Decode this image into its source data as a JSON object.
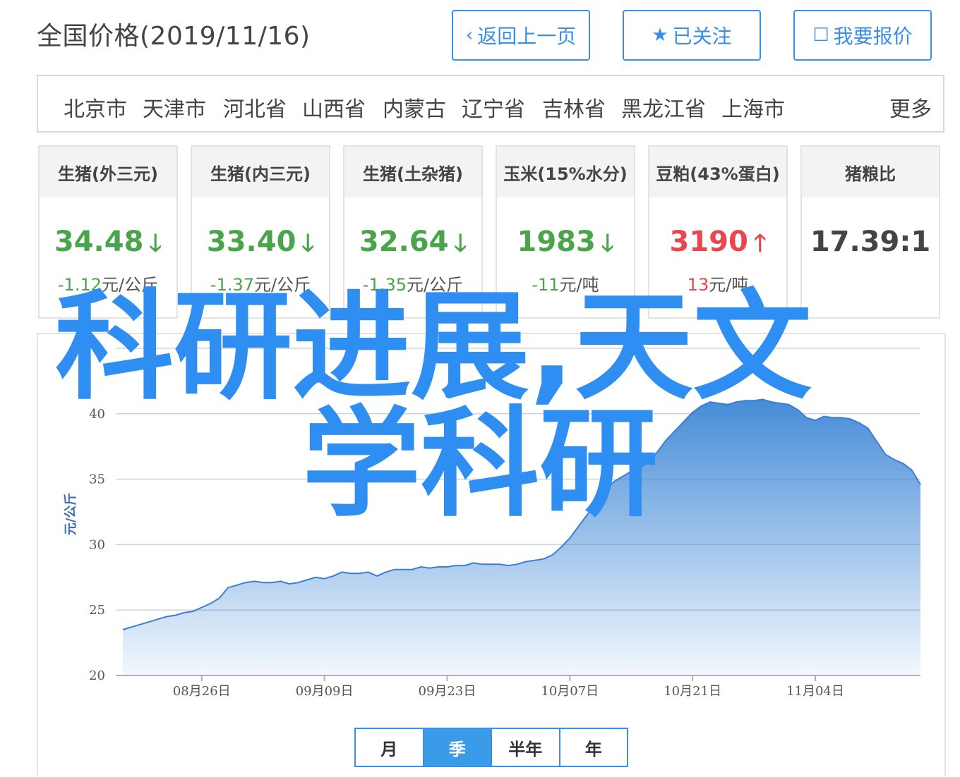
{
  "header": {
    "title": "全国价格(2019/11/16)",
    "back_label": "返回上一页",
    "follow_label": "已关注",
    "report_label": "我要报价"
  },
  "regions": [
    "北京市",
    "天津市",
    "河北省",
    "山西省",
    "内蒙古",
    "辽宁省",
    "吉林省",
    "黑龙江省",
    "上海市"
  ],
  "regions_more": "更多",
  "cards": [
    {
      "title": "生猪(外三元)",
      "value": "34.48",
      "trend": "down",
      "change_num": "-1.12",
      "change_unit": "元/公斤"
    },
    {
      "title": "生猪(内三元)",
      "value": "33.40",
      "trend": "down",
      "change_num": "-1.37",
      "change_unit": "元/公斤"
    },
    {
      "title": "生猪(土杂猪)",
      "value": "32.64",
      "trend": "down",
      "change_num": "-1.35",
      "change_unit": "元/公斤"
    },
    {
      "title": "玉米(15%水分)",
      "value": "1983",
      "trend": "down",
      "change_num": "-11",
      "change_unit": "元/吨"
    },
    {
      "title": "豆粕(43%蛋白)",
      "value": "3190",
      "trend": "up",
      "change_num": "13",
      "change_unit": "元/吨"
    },
    {
      "title": "猪粮比",
      "value": "17.39:1",
      "trend": "none",
      "change_num": "",
      "change_unit": ""
    }
  ],
  "colors": {
    "accent": "#3a8ee6",
    "down": "#4aa44a",
    "up": "#e8474d",
    "area": "#3c86d6"
  },
  "periods": [
    {
      "label": "月",
      "active": false
    },
    {
      "label": "季",
      "active": true
    },
    {
      "label": "半年",
      "active": false
    },
    {
      "label": "年",
      "active": false
    }
  ],
  "watermark": {
    "line1": "科研进展,天文",
    "line2": "学科研"
  },
  "chart_data": {
    "type": "area",
    "ylabel": "元/公斤",
    "ylim": [
      20,
      45
    ],
    "yticks": [
      20,
      25,
      30,
      35,
      40
    ],
    "grid": true,
    "x_start": "2019-08-17",
    "x_end": "2019-11-16",
    "x_ticks": [
      "08月26日",
      "09月09日",
      "09月23日",
      "10月07日",
      "10月21日",
      "11月04日"
    ],
    "x_tick_days": [
      9,
      23,
      37,
      51,
      65,
      79
    ],
    "days": [
      0,
      2,
      3,
      4,
      5,
      6,
      7,
      8,
      9,
      10,
      11,
      12,
      13,
      14,
      15,
      16,
      17,
      18,
      19,
      20,
      21,
      22,
      23,
      24,
      25,
      26,
      27,
      28,
      29,
      30,
      31,
      32,
      33,
      34,
      35,
      36,
      37,
      38,
      39,
      40,
      41,
      42,
      43,
      44,
      45,
      46,
      47,
      48,
      49,
      50,
      51,
      52,
      53,
      54,
      55,
      56,
      57,
      58,
      59,
      60,
      61,
      62,
      63,
      64,
      65,
      66,
      67,
      68,
      69,
      70,
      71,
      72,
      73,
      74,
      75,
      76,
      77,
      78,
      79,
      80,
      81,
      82,
      83,
      84,
      85,
      86,
      87,
      88,
      89,
      90,
      91
    ],
    "values": [
      23.5,
      23.9,
      24.1,
      24.3,
      24.5,
      24.6,
      24.8,
      24.9,
      25.2,
      25.5,
      25.9,
      26.7,
      26.9,
      27.1,
      27.2,
      27.1,
      27.1,
      27.2,
      27.0,
      27.1,
      27.3,
      27.5,
      27.4,
      27.6,
      27.9,
      27.8,
      27.8,
      27.9,
      27.6,
      27.9,
      28.1,
      28.1,
      28.1,
      28.3,
      28.2,
      28.3,
      28.3,
      28.4,
      28.4,
      28.6,
      28.5,
      28.5,
      28.5,
      28.4,
      28.5,
      28.7,
      28.8,
      28.9,
      29.2,
      29.8,
      30.5,
      31.4,
      32.3,
      33.3,
      34.1,
      34.8,
      35.2,
      35.6,
      35.9,
      36.3,
      37.1,
      38.0,
      38.7,
      39.4,
      40.1,
      40.6,
      40.9,
      40.8,
      40.7,
      40.9,
      41.0,
      41.0,
      41.1,
      40.9,
      40.8,
      40.7,
      40.3,
      39.7,
      39.5,
      39.8,
      39.7,
      39.7,
      39.6,
      39.3,
      38.9,
      37.9,
      36.9,
      36.5,
      36.2,
      35.7,
      34.6
    ]
  }
}
